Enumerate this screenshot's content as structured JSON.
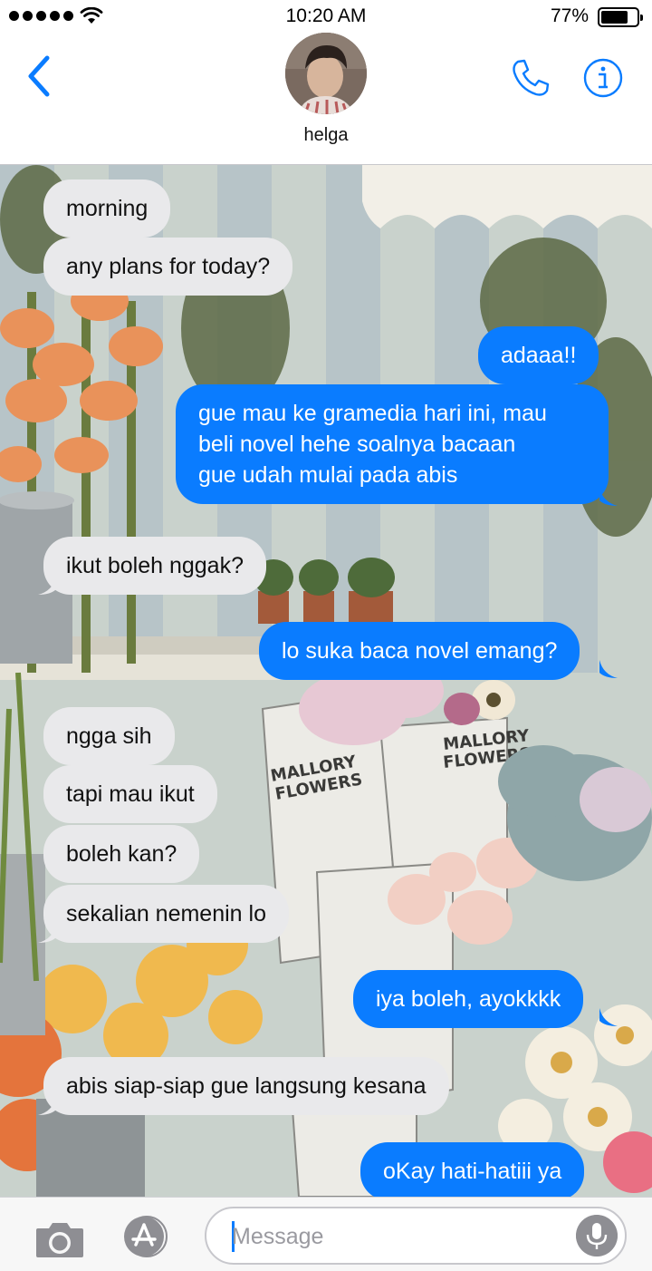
{
  "status_bar": {
    "time": "10:20 AM",
    "battery_percent": "77%",
    "battery_level": 0.77,
    "signal_dots": 5
  },
  "header": {
    "contact_name": "helga",
    "icons": {
      "back": "chevron-left-icon",
      "phone": "phone-icon",
      "info": "info-icon"
    }
  },
  "conversation": {
    "messages": [
      {
        "from": "them",
        "text": "morning"
      },
      {
        "from": "them",
        "text": "any plans for today?"
      },
      {
        "from": "me",
        "text": "adaaa!!"
      },
      {
        "from": "me",
        "lines": [
          "gue mau ke gramedia hari ini, mau",
          "beli novel hehe soalnya bacaan",
          "gue udah mulai pada abis"
        ]
      },
      {
        "from": "them",
        "text": "ikut boleh nggak?"
      },
      {
        "from": "me",
        "text": "lo suka baca novel emang?"
      },
      {
        "from": "them",
        "text": "ngga sih"
      },
      {
        "from": "them",
        "text": "tapi mau ikut"
      },
      {
        "from": "them",
        "text": "boleh kan?"
      },
      {
        "from": "them",
        "text": "sekalian nemenin lo"
      },
      {
        "from": "me",
        "text": "iya boleh, ayokkkk"
      },
      {
        "from": "them",
        "text": "abis siap-siap gue langsung kesana"
      },
      {
        "from": "me",
        "text": "oKay hati-hatiii ya"
      }
    ]
  },
  "composer": {
    "placeholder": "Message",
    "icons": {
      "camera": "camera-icon",
      "apps": "app-store-icon",
      "mic": "microphone-icon"
    }
  },
  "colors": {
    "accent": "#0a7cff",
    "incoming_bubble": "#e9e9eb",
    "outgoing_bubble": "#0a7cff"
  }
}
